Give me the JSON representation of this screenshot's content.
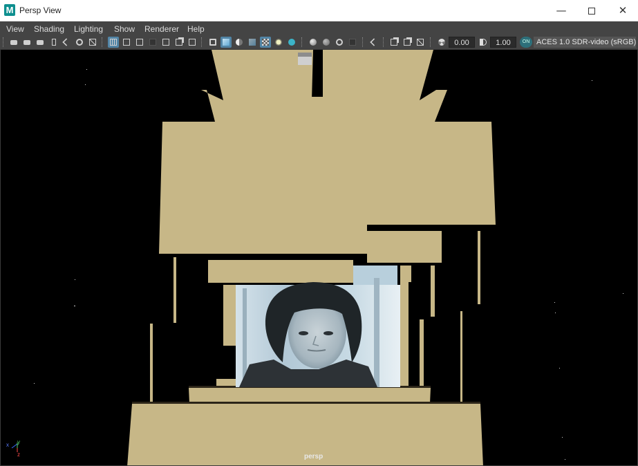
{
  "window": {
    "title": "Persp View",
    "app_icon_letter": "M",
    "minimize_glyph": "—",
    "close_glyph": "✕"
  },
  "menu": [
    {
      "label": "View"
    },
    {
      "label": "Shading"
    },
    {
      "label": "Lighting"
    },
    {
      "label": "Show"
    },
    {
      "label": "Renderer"
    },
    {
      "label": "Help"
    }
  ],
  "toolbar": {
    "exposure_value": "0.00",
    "gamma_value": "1.00",
    "color_management_badge": "ON",
    "color_space": "ACES 1.0 SDR-video (sRGB)"
  },
  "viewport": {
    "camera_name": "persp",
    "background_color": "#000000",
    "surface_color": "#c7b787",
    "axis_labels": {
      "y": "y",
      "x": "x",
      "z": "z"
    }
  }
}
